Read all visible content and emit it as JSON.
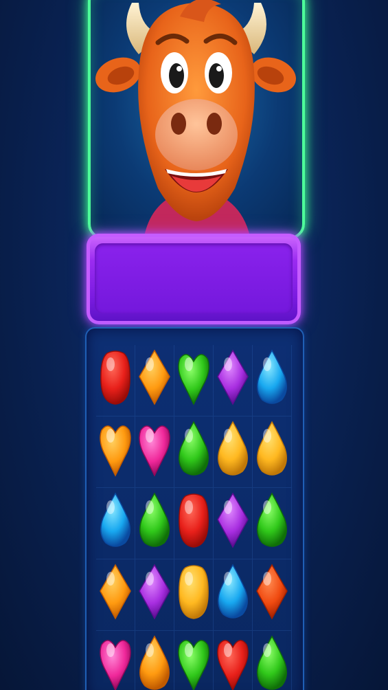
{
  "game": {
    "character": "bull-mascot",
    "banner_text": ""
  },
  "colors": {
    "frame_glow": "#4dff9a",
    "banner": "#9a2bf0",
    "board_border": "#1f5fb5",
    "background": "#0a2458"
  },
  "board": {
    "columns": 5,
    "rows": [
      [
        {
          "shape": "rounded",
          "color": "red"
        },
        {
          "shape": "diamond",
          "color": "orange"
        },
        {
          "shape": "heart",
          "color": "green"
        },
        {
          "shape": "diamond",
          "color": "purple"
        },
        {
          "shape": "drop",
          "color": "blue"
        }
      ],
      [
        {
          "shape": "heart",
          "color": "orange"
        },
        {
          "shape": "heart",
          "color": "pink"
        },
        {
          "shape": "drop",
          "color": "green"
        },
        {
          "shape": "drop",
          "color": "yellow"
        },
        {
          "shape": "drop",
          "color": "yellow"
        }
      ],
      [
        {
          "shape": "drop",
          "color": "blue"
        },
        {
          "shape": "drop",
          "color": "green"
        },
        {
          "shape": "rounded",
          "color": "red"
        },
        {
          "shape": "diamond",
          "color": "purple"
        },
        {
          "shape": "drop",
          "color": "green"
        }
      ],
      [
        {
          "shape": "diamond",
          "color": "orange"
        },
        {
          "shape": "diamond",
          "color": "purple"
        },
        {
          "shape": "rounded",
          "color": "yellow"
        },
        {
          "shape": "drop",
          "color": "blue"
        },
        {
          "shape": "diamond",
          "color": "red-orange"
        }
      ],
      [
        {
          "shape": "heart",
          "color": "pink"
        },
        {
          "shape": "drop",
          "color": "orange"
        },
        {
          "shape": "heart",
          "color": "green"
        },
        {
          "shape": "heart",
          "color": "red"
        },
        {
          "shape": "drop",
          "color": "green"
        }
      ]
    ]
  }
}
